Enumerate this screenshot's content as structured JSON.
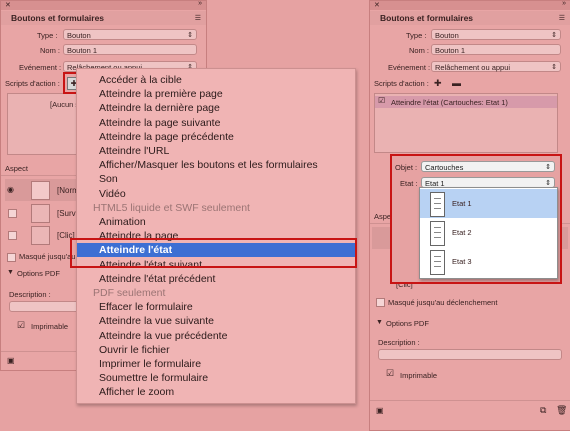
{
  "left_panel": {
    "title": "Boutons et formulaires",
    "type_label": "Type :",
    "type_value": "Bouton",
    "name_label": "Nom :",
    "name_value": "Bouton 1",
    "event_label": "Evénement :",
    "event_value": "Relâchement ou appui",
    "scripts_label": "Scripts d'action :",
    "actions_empty": "[Aucun s",
    "aspect_label": "Aspect",
    "state_normal": "[Norm",
    "state_rollover": "[Survol",
    "state_click": "[Clic]",
    "hidden_label": "Masqué jusqu'au d",
    "pdf_options": "Options PDF",
    "description_label": "Description :",
    "printable_label": "Imprimable"
  },
  "menu": {
    "items": [
      {
        "label": "Accéder à la cible",
        "kind": "item"
      },
      {
        "label": "Atteindre la première page",
        "kind": "item"
      },
      {
        "label": "Atteindre la dernière page",
        "kind": "item"
      },
      {
        "label": "Atteindre la page suivante",
        "kind": "item"
      },
      {
        "label": "Atteindre la page précédente",
        "kind": "item"
      },
      {
        "label": "Atteindre l'URL",
        "kind": "item"
      },
      {
        "label": "Afficher/Masquer les boutons et les formulaires",
        "kind": "item"
      },
      {
        "label": "Son",
        "kind": "item"
      },
      {
        "label": "Vidéo",
        "kind": "item"
      },
      {
        "label": "HTML5 liquide et SWF seulement",
        "kind": "header"
      },
      {
        "label": "Animation",
        "kind": "item"
      },
      {
        "label": "Atteindre la page",
        "kind": "item"
      },
      {
        "label": "Atteindre l'état",
        "kind": "selected"
      },
      {
        "label": "Atteindre l'état suivant",
        "kind": "item"
      },
      {
        "label": "Atteindre l'état précédent",
        "kind": "item"
      },
      {
        "label": "PDF seulement",
        "kind": "header"
      },
      {
        "label": "Effacer le formulaire",
        "kind": "item"
      },
      {
        "label": "Atteindre la vue suivante",
        "kind": "item"
      },
      {
        "label": "Atteindre la vue précédente",
        "kind": "item"
      },
      {
        "label": "Ouvrir le fichier",
        "kind": "item"
      },
      {
        "label": "Imprimer le formulaire",
        "kind": "item"
      },
      {
        "label": "Soumettre le formulaire",
        "kind": "item"
      },
      {
        "label": "Afficher le zoom",
        "kind": "item"
      }
    ]
  },
  "right_panel": {
    "title": "Boutons et formulaires",
    "type_label": "Type :",
    "type_value": "Bouton",
    "name_label": "Nom :",
    "name_value": "Bouton 1",
    "event_label": "Evénement :",
    "event_value": "Relâchement ou appui",
    "scripts_label": "Scripts d'action :",
    "action_item": "Atteindre l'état (Cartouches: Etat 1)",
    "object_label": "Objet :",
    "object_value": "Cartouches",
    "state_label": "Etat :",
    "state_value": "Etat 1",
    "aspect_label": "Aspect",
    "state_click": "[Clic]",
    "hidden_label": "Masqué jusqu'au déclenchement",
    "pdf_options": "Options PDF",
    "description_label": "Description :",
    "printable_label": "Imprimable"
  },
  "state_dropdown": {
    "items": [
      "Etat 1",
      "Etat 2",
      "Etat 3"
    ],
    "selected_index": 0
  },
  "colors": {
    "highlight": "#3d6fd3",
    "callout": "#c81414"
  }
}
